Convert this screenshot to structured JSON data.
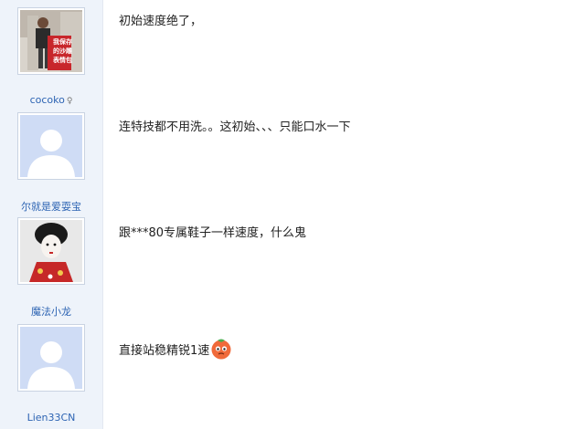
{
  "posts": [
    {
      "username": "cocoko",
      "avatar": "photo-person-with-sign",
      "avatar_caption": "我保存的沙雕表情包",
      "gender_icon": "user-badge-icon",
      "content": "初始速度绝了，"
    },
    {
      "username": "尔就是爱耍宝",
      "avatar": "default-avatar",
      "content": "连特技都不用洗。。这初始、、、只能口水一下"
    },
    {
      "username": "魔法小龙",
      "avatar": "photo-geisha",
      "content": "跟***80专属鞋子一样速度，什么鬼"
    },
    {
      "username": "Lien33CN",
      "avatar": "default-avatar",
      "content": "直接站稳精锐1速",
      "emoji": "tomato-face-emoji"
    }
  ],
  "colors": {
    "sidebar_bg": "#eef3fa",
    "username": "#2d64b3",
    "default_avatar_bg": "#cfdcf5"
  }
}
